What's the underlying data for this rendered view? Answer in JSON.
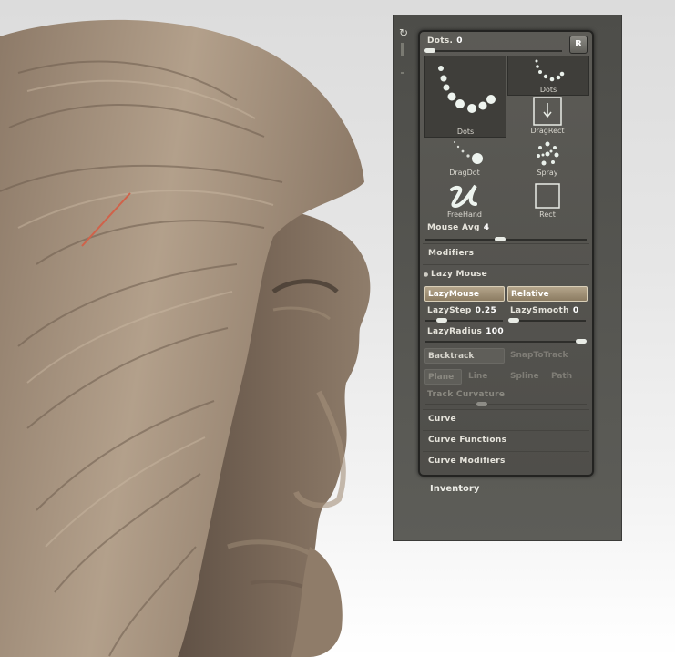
{
  "stroke_palette": {
    "dots_label": "Dots.",
    "dots_value": "0",
    "reset_button": "R",
    "tiles": {
      "dots_big": "Dots",
      "dots_small": "Dots",
      "dragrect": "DragRect",
      "dragdot": "DragDot",
      "spray": "Spray",
      "freehand": "FreeHand",
      "rect": "Rect"
    },
    "mouse_avg_label": "Mouse Avg",
    "mouse_avg_value": "4",
    "mouse_avg_level": 0.5,
    "modifiers_label": "Modifiers",
    "lazy_mouse_label": "Lazy Mouse",
    "lazymouse_button": "LazyMouse",
    "relative_button": "Relative",
    "lazystep_label": "LazyStep",
    "lazystep_value": "0.25",
    "lazysmooth_label": "LazySmooth",
    "lazysmooth_value": "0",
    "lazyradius_label": "LazyRadius",
    "lazyradius_value": "100",
    "backtrack_button": "Backtrack",
    "snaptotrack_button": "SnapToTrack",
    "plane_button": "Plane",
    "line_button": "Line",
    "spline_button": "Spline",
    "path_button": "Path",
    "track_curvature_label": "Track Curvature",
    "curve_label": "Curve",
    "curve_functions_label": "Curve Functions",
    "curve_modifiers_label": "Curve Modifiers"
  },
  "outer_palette": {
    "inventory_label": "Inventory"
  },
  "colors": {
    "accent_button": "#a8987c",
    "panel": "#57564f",
    "sculpt": "#9e8b78"
  }
}
